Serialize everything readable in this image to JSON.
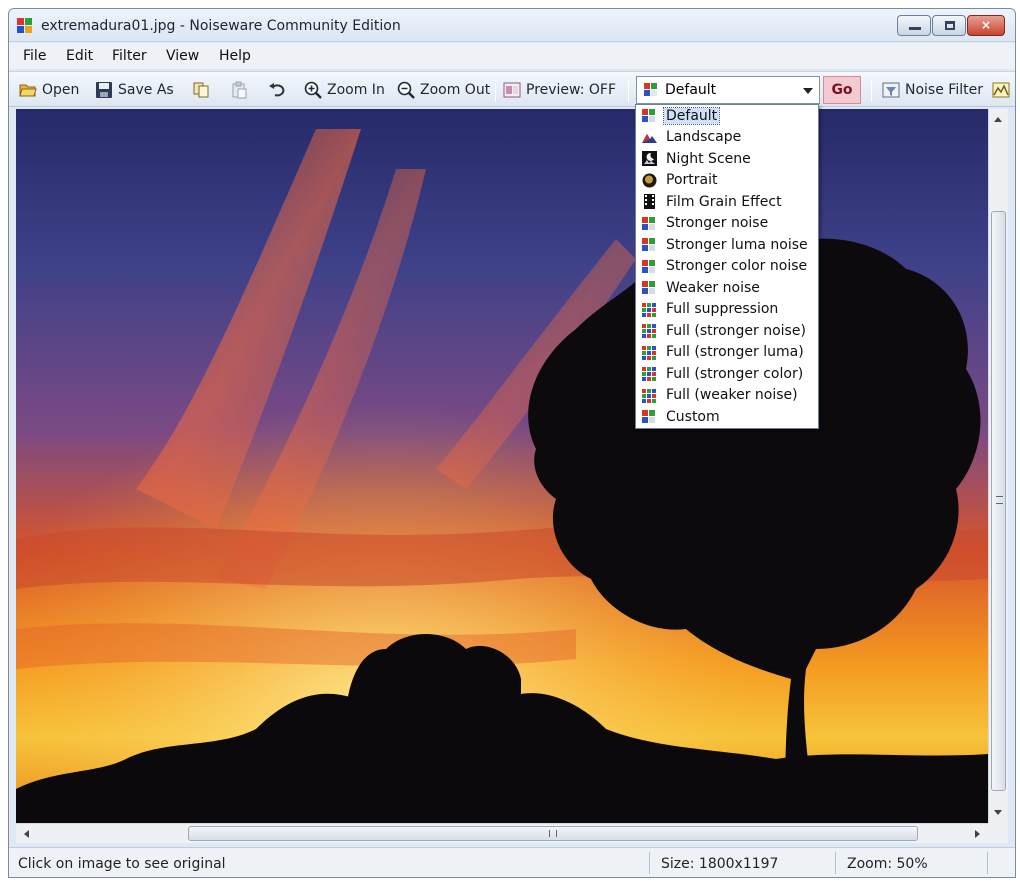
{
  "window": {
    "title": "extremadura01.jpg - Noiseware Community Edition",
    "controls": {
      "minimize": "minimize-icon",
      "maximize": "maximize-icon",
      "close": "×"
    }
  },
  "menu": [
    "File",
    "Edit",
    "Filter",
    "View",
    "Help"
  ],
  "toolbar": {
    "open": "Open",
    "save_as": "Save As",
    "copy_icon": "copy-icon",
    "paste_icon": "paste-icon",
    "undo_icon": "undo-icon",
    "zoom_in": "Zoom In",
    "zoom_out": "Zoom Out",
    "preview": "Preview: OFF",
    "preset_selected": "Default",
    "go": "Go",
    "noise_filter": "Noise Filter"
  },
  "presets": [
    {
      "label": "Default",
      "icon": "preset-color-icon"
    },
    {
      "label": "Landscape",
      "icon": "landscape-icon"
    },
    {
      "label": "Night Scene",
      "icon": "night-scene-icon"
    },
    {
      "label": "Portrait",
      "icon": "portrait-icon"
    },
    {
      "label": "Film Grain Effect",
      "icon": "film-grain-icon"
    },
    {
      "label": "Stronger noise",
      "icon": "preset-color-icon"
    },
    {
      "label": "Stronger luma noise",
      "icon": "preset-color-icon"
    },
    {
      "label": "Stronger color noise",
      "icon": "preset-color-icon"
    },
    {
      "label": "Weaker noise",
      "icon": "preset-color-icon"
    },
    {
      "label": "Full suppression",
      "icon": "preset-full-icon"
    },
    {
      "label": "Full (stronger noise)",
      "icon": "preset-full-icon"
    },
    {
      "label": "Full (stronger luma)",
      "icon": "preset-full-icon"
    },
    {
      "label": "Full (stronger color)",
      "icon": "preset-full-icon"
    },
    {
      "label": "Full (weaker noise)",
      "icon": "preset-full-icon"
    },
    {
      "label": "Custom",
      "icon": "preset-color-icon"
    }
  ],
  "status": {
    "hint": "Click on image to see original",
    "size": "Size: 1800x1197",
    "zoom": "Zoom: 50%"
  },
  "colors": {
    "accent": "#cfe0f7",
    "go_button": "#f4c9cf",
    "sky_top": "#2b2f6e",
    "sunset_glow": "#f6a21c"
  }
}
